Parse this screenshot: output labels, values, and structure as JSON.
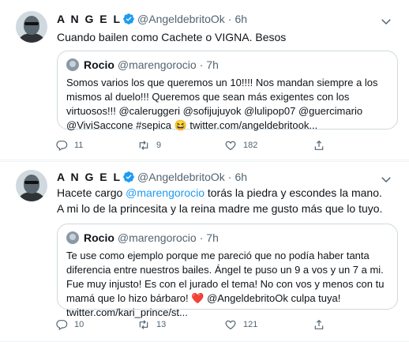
{
  "tweets": [
    {
      "author": "A N G E L",
      "handle": "@AngeldebritoOk",
      "separator": "·",
      "time": "6h",
      "text_lines": [
        [
          {
            "t": "Cuando bailen como Cachete o VIGNA. Besos"
          }
        ]
      ],
      "quote": {
        "author": "Rocio",
        "handle": "@marengorocio",
        "separator": "·",
        "time": "7h",
        "lines": [
          "Somos varios los que queremos un 10!!!! Nos mandan siempre a los",
          "mismos al duelo!!! Queremos que sean más exigentes con los",
          "virtuosos!!!  @caleruggeri @sofijujuyok @lulipop07 @guercimario",
          "@ViviSaccone #sepica 😆 twitter.com/angeldebritook..."
        ]
      },
      "stats": {
        "replies": "11",
        "retweets": "9",
        "likes": "182"
      }
    },
    {
      "author": "A N G E L",
      "handle": "@AngeldebritoOk",
      "separator": "·",
      "time": "6h",
      "line1_before": "Hacete cargo ",
      "line1_mention": "@marengorocio",
      "line1_after": " torás la piedra y escondes la mano.",
      "line2": "A mi lo de la princesita y la reina madre me gusto más que lo tuyo.",
      "quote": {
        "author": "Rocio",
        "handle": "@marengorocio",
        "separator": "·",
        "time": "7h",
        "lines": [
          "Te use como ejemplo porque me pareció que no podía haber tanta",
          "diferencia entre nuestros bailes. Ángel te puso un 9 a vos y un 7 a mi.",
          "Fue muy injusto! Es con el jurado el tema! No con vos y menos con tu",
          "twitter.com/kari_prince/st..."
        ],
        "line4_before": "mamá que lo hizo bárbaro! ",
        "line4_heart": "❤️",
        "line4_after": " @AngeldebritoOk culpa tuya!"
      },
      "stats": {
        "replies": "10",
        "retweets": "13",
        "likes": "121"
      }
    }
  ],
  "colors": {
    "accent": "#1d9bf0",
    "muted": "#536471",
    "border": "#cfd9de",
    "heart": "#e0245e"
  },
  "icons": [
    "verified-badge-icon",
    "caret-down-icon",
    "reply-icon",
    "retweet-icon",
    "like-icon",
    "share-icon"
  ]
}
